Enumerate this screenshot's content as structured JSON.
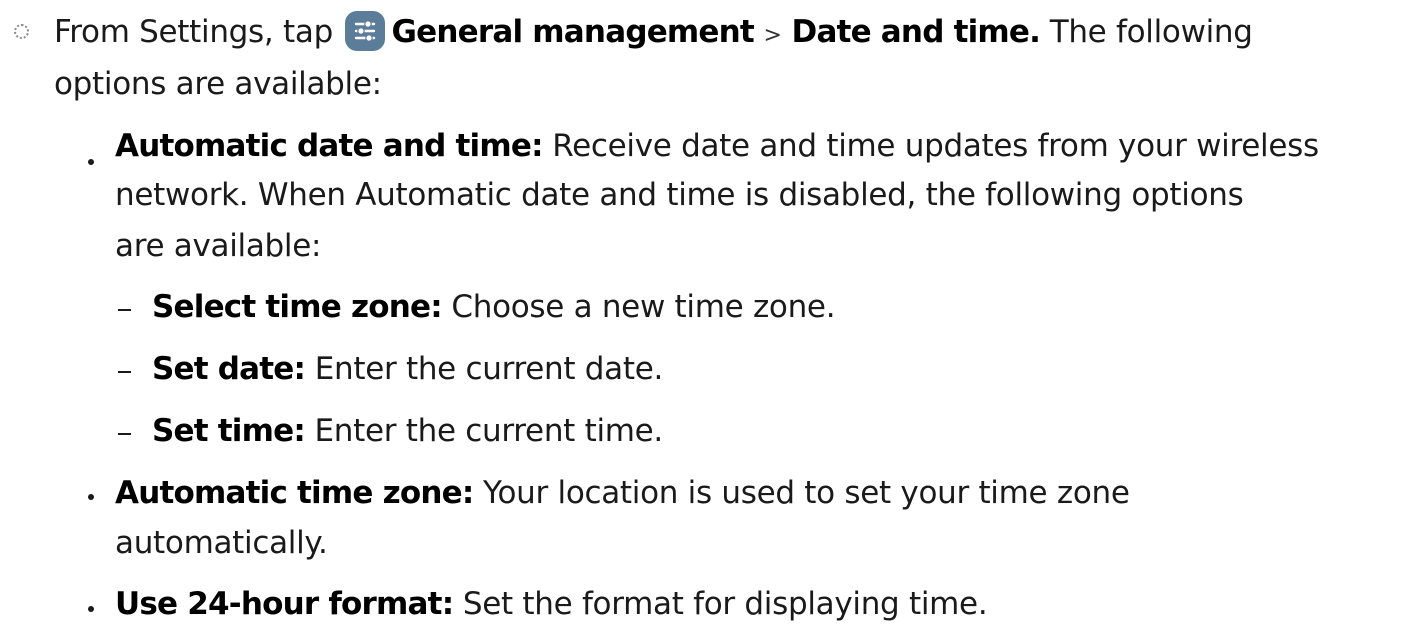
{
  "step": {
    "prefix": "From Settings, tap",
    "icon": "settings-sliders-icon",
    "icon_color": "#5c7d9a",
    "menu_general": "General management",
    "separator": ">",
    "menu_date": "Date and time.",
    "suffix": "The following",
    "line2": "options are available:"
  },
  "options": [
    {
      "title": "Automatic date and time",
      "colon": ":",
      "desc_line1": "Receive date and time updates from your wireless",
      "desc_line2": "network. When Automatic date and time is disabled, the following options",
      "desc_line3": "are available:",
      "sub_options": [
        {
          "title": "Select time zone",
          "colon": ":",
          "desc": "Choose a new time zone."
        },
        {
          "title": "Set date",
          "colon": ":",
          "desc": "Enter the current date."
        },
        {
          "title": "Set time",
          "colon": ":",
          "desc": "Enter the current time."
        }
      ]
    },
    {
      "title": "Automatic time zone",
      "colon": ":",
      "desc_line1": "Your location is used to set your time zone",
      "desc_line2": "automatically."
    },
    {
      "title": "Use 24-hour format",
      "colon": ":",
      "desc_line1": "Set the format for displaying time."
    }
  ]
}
